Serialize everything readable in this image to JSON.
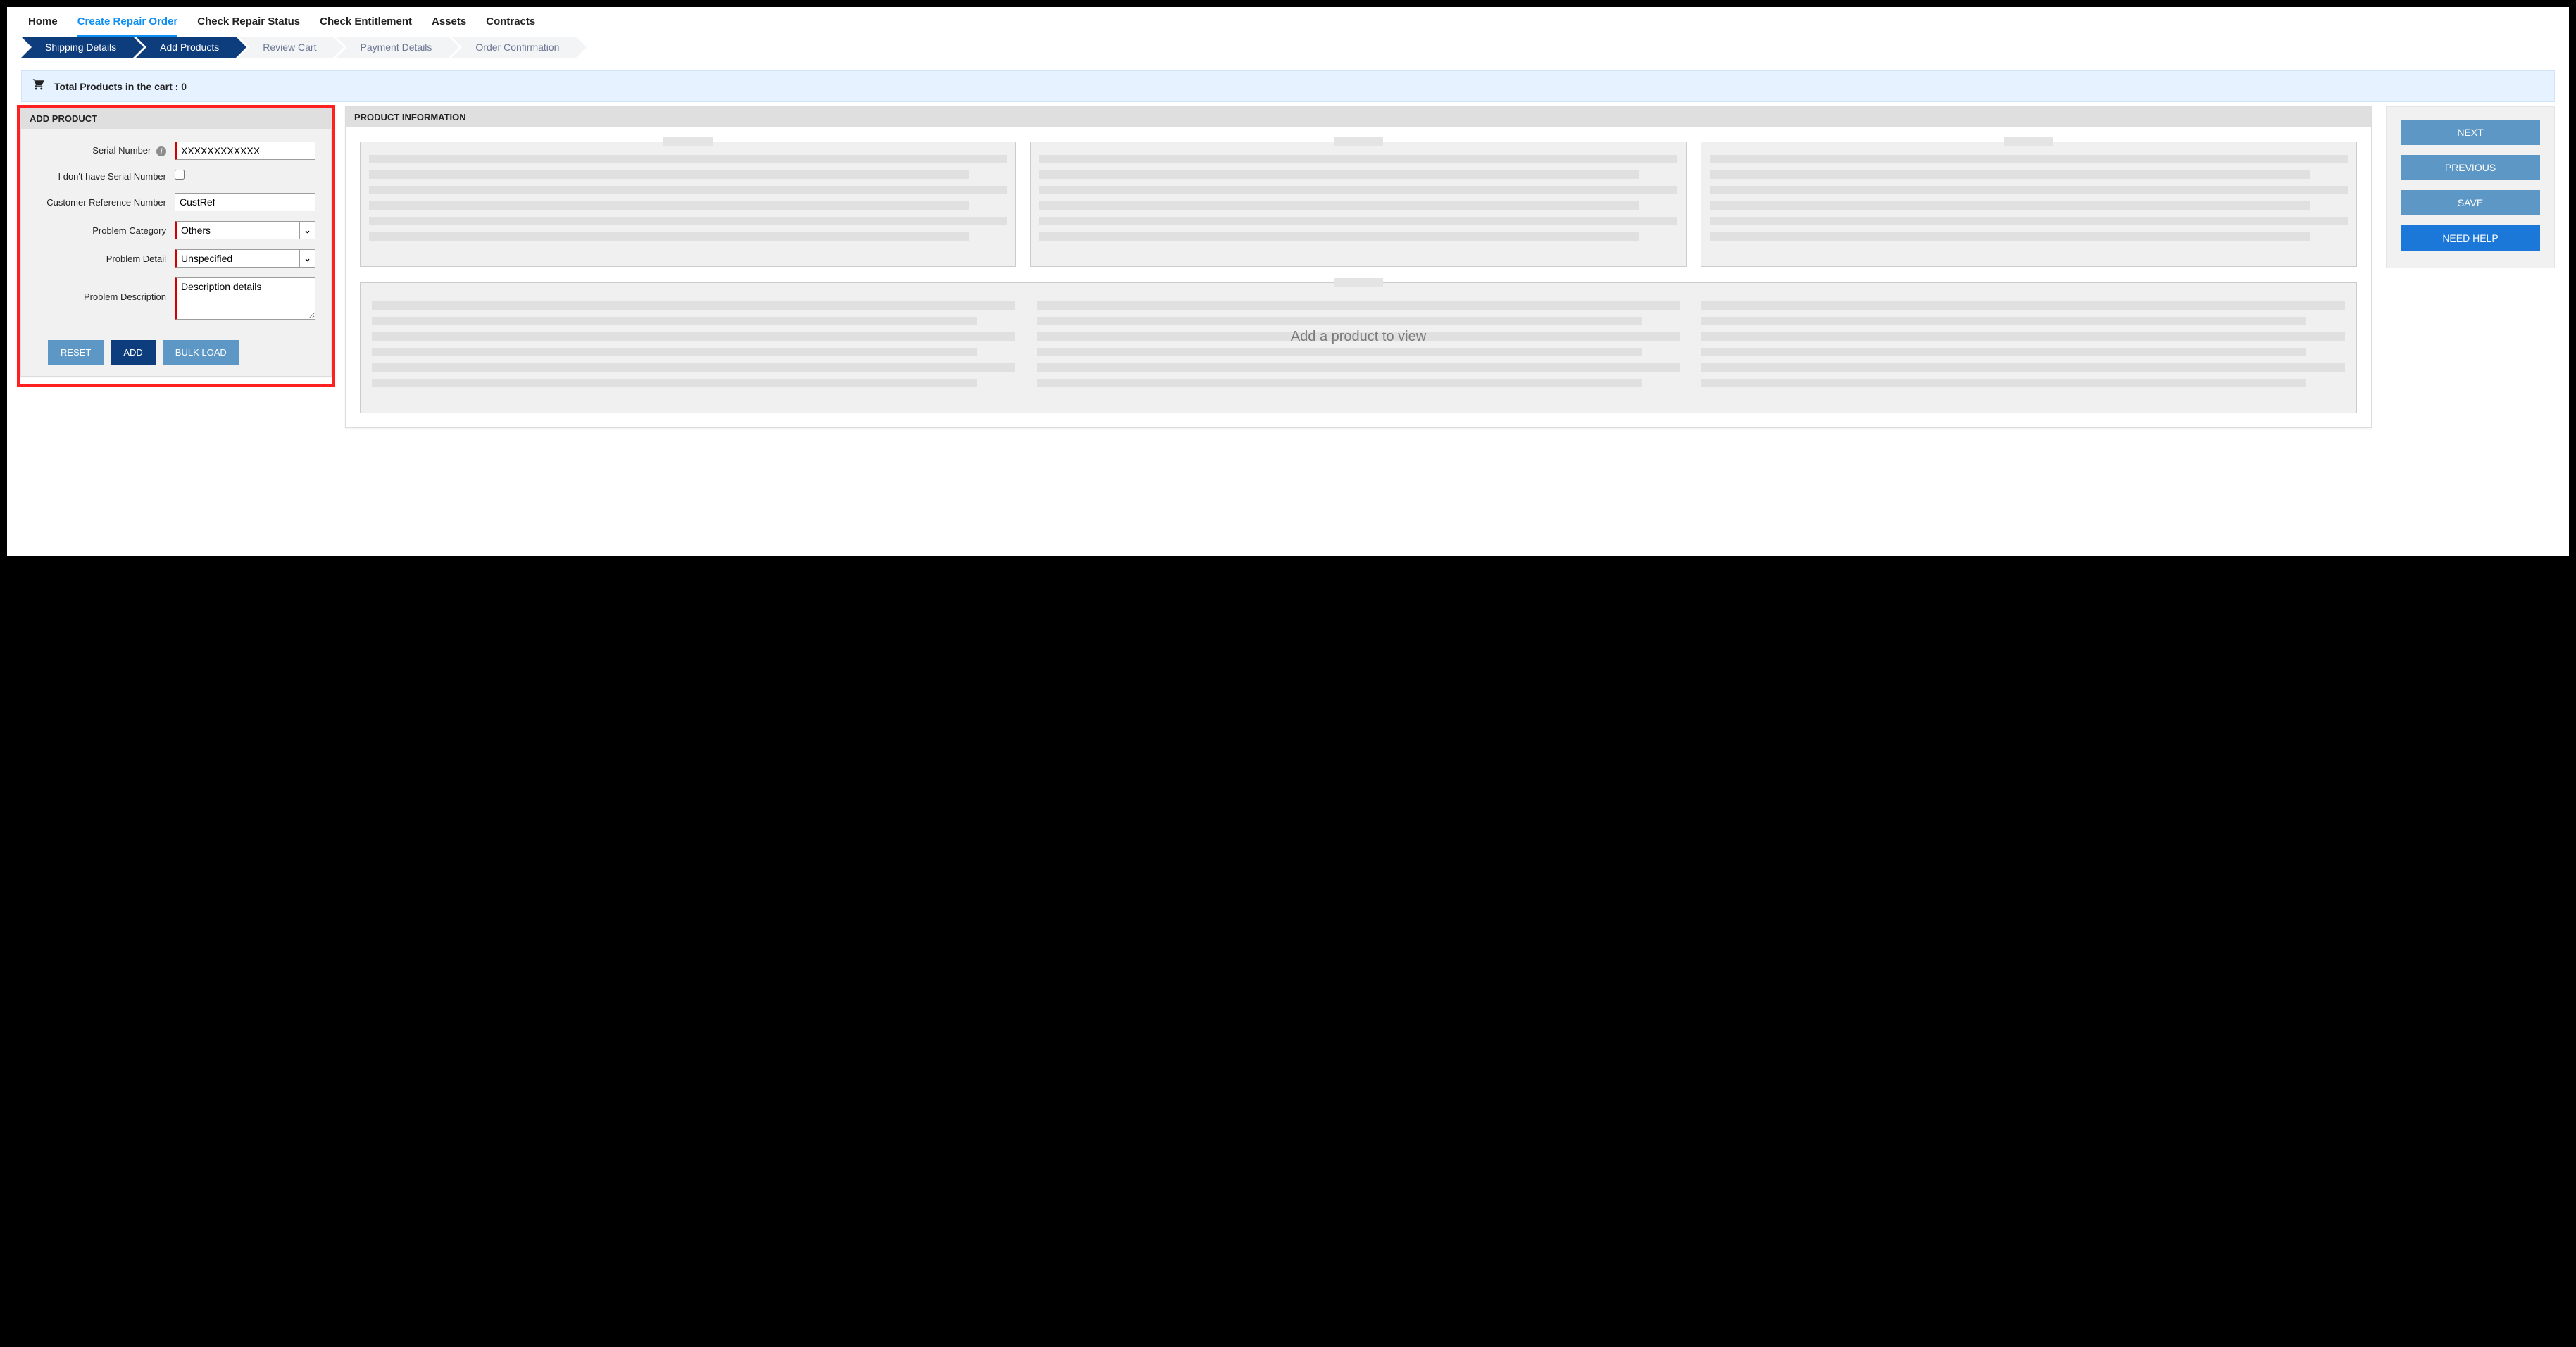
{
  "nav": {
    "items": [
      "Home",
      "Create Repair Order",
      "Check Repair Status",
      "Check Entitlement",
      "Assets",
      "Contracts"
    ],
    "active_index": 1
  },
  "steps": {
    "items": [
      "Shipping Details",
      "Add Products",
      "Review Cart",
      "Payment Details",
      "Order Confirmation"
    ],
    "done_through_index": 1
  },
  "cart": {
    "label": "Total Products in the cart : 0"
  },
  "add_product": {
    "title": "ADD PRODUCT",
    "fields": {
      "serial_label": "Serial Number",
      "serial_value": "XXXXXXXXXXXX",
      "no_serial_label": "I don't have Serial Number",
      "no_serial_checked": false,
      "custref_label": "Customer Reference Number",
      "custref_value": "CustRef",
      "category_label": "Problem Category",
      "category_value": "Others",
      "detail_label": "Problem Detail",
      "detail_value": "Unspecified",
      "desc_label": "Problem Description",
      "desc_value": "Description details"
    },
    "buttons": {
      "reset": "RESET",
      "add": "ADD",
      "bulk": "BULK LOAD"
    }
  },
  "product_info": {
    "title": "PRODUCT INFORMATION",
    "placeholder_text": "Add a product to view"
  },
  "actions": {
    "next": "NEXT",
    "previous": "PREVIOUS",
    "save": "SAVE",
    "help": "NEED HELP"
  }
}
